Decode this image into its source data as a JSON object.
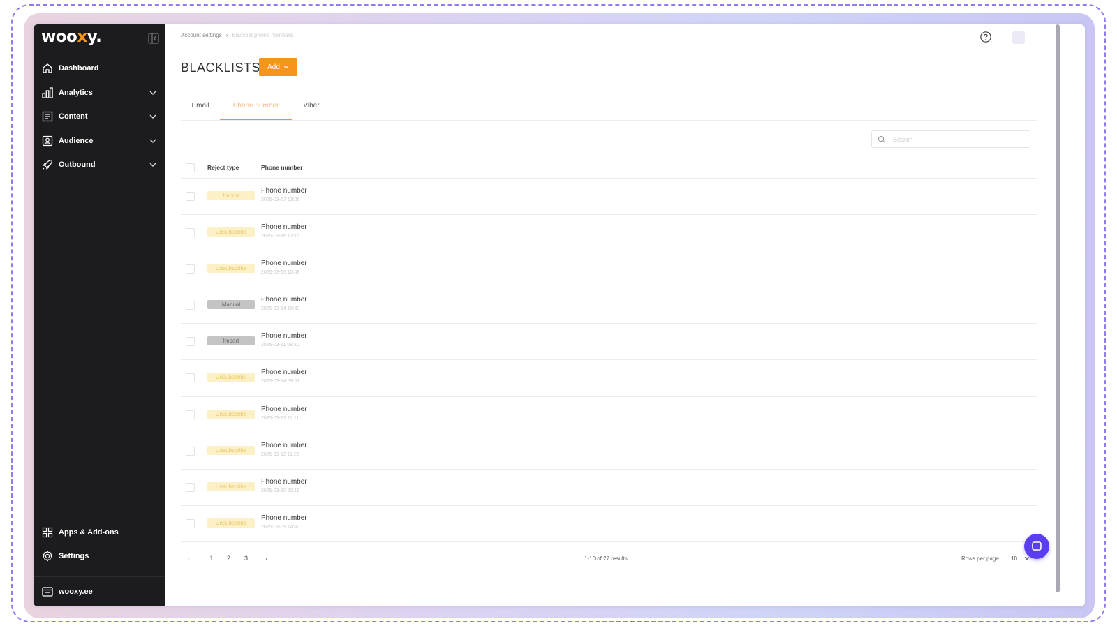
{
  "brand": {
    "logo_prefix": "woo",
    "logo_x": "x",
    "logo_suffix": "y.",
    "accent_color": "#f7941d",
    "sidebar_bg": "#1c1c1e"
  },
  "sidebar": {
    "items": [
      {
        "label": "Dashboard",
        "icon": "home-icon",
        "expandable": false
      },
      {
        "label": "Analytics",
        "icon": "bar-chart-icon",
        "expandable": true
      },
      {
        "label": "Content",
        "icon": "content-icon",
        "expandable": true
      },
      {
        "label": "Audience",
        "icon": "audience-icon",
        "expandable": true
      },
      {
        "label": "Outbound",
        "icon": "rocket-icon",
        "expandable": true
      }
    ],
    "bottom_items": [
      {
        "label": "Apps & Add-ons",
        "icon": "apps-grid-icon"
      },
      {
        "label": "Settings",
        "icon": "gear-icon"
      }
    ],
    "site": {
      "label": "wooxy.ee",
      "icon": "browser-icon"
    }
  },
  "header": {
    "breadcrumb": [
      "Account settings",
      "Blacklist phone numbers"
    ],
    "help_icon": "help-icon"
  },
  "page": {
    "title": "BLACKLISTS",
    "add_button": "Add",
    "tabs": [
      {
        "label": "Email",
        "active": false
      },
      {
        "label": "Phone number",
        "active": true
      },
      {
        "label": "Viber",
        "active": false
      }
    ],
    "search_placeholder": "Search"
  },
  "table": {
    "columns": [
      "Reject type",
      "Phone number"
    ],
    "rows": [
      {
        "reject_type": "Import",
        "badge": "pending",
        "phone": "Phone number",
        "date": "2025-03-17 13:06"
      },
      {
        "reject_type": "Unsubscribe",
        "badge": "pending",
        "phone": "Phone number",
        "date": "2025-03-16 12:15"
      },
      {
        "reject_type": "Unsubscribe",
        "badge": "pending",
        "phone": "Phone number",
        "date": "2025-03-15 10:48"
      },
      {
        "reject_type": "Manual",
        "badge": "manual",
        "phone": "Phone number",
        "date": "2025-03-14 16:49"
      },
      {
        "reject_type": "Import",
        "badge": "import",
        "phone": "Phone number",
        "date": "2025-03-11 08:30"
      },
      {
        "reject_type": "Unsubscribe",
        "badge": "pending",
        "phone": "Phone number",
        "date": "2025-03-14 09:01"
      },
      {
        "reject_type": "Unsubscribe",
        "badge": "pending",
        "phone": "Phone number",
        "date": "2025-03-12 11:11"
      },
      {
        "reject_type": "Unsubscribe",
        "badge": "pending",
        "phone": "Phone number",
        "date": "2025-03-12 11:25"
      },
      {
        "reject_type": "Unsubscribe",
        "badge": "pending",
        "phone": "Phone number",
        "date": "2025-03-10 20:15"
      },
      {
        "reject_type": "Unsubscribe",
        "badge": "pending",
        "phone": "Phone number",
        "date": "2025-03-09 14:43"
      }
    ]
  },
  "pagination": {
    "pages": [
      "1",
      "2",
      "3"
    ],
    "current": "1",
    "results": "1-10 of 27 results",
    "rows_per_page_label": "Rows per page",
    "rows_per_page": "10"
  }
}
